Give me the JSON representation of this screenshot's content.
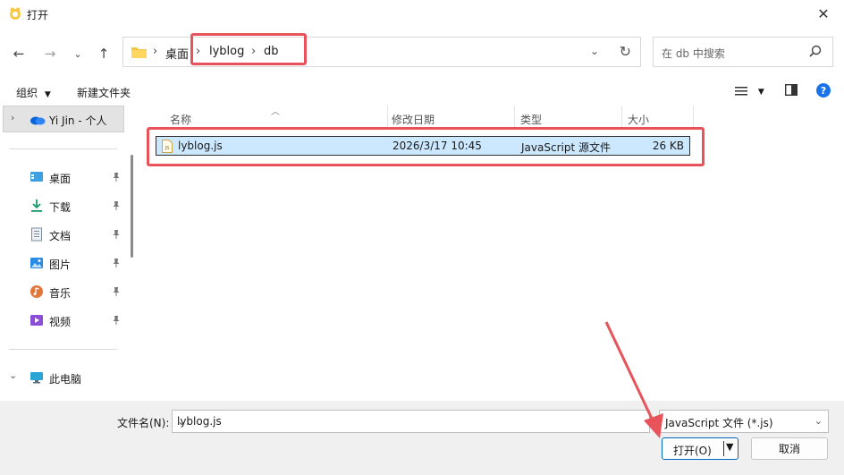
{
  "window": {
    "title": "打开"
  },
  "address": {
    "crumbs": [
      "桌面",
      "lyblog",
      "db"
    ],
    "separator": "›"
  },
  "search": {
    "placeholder": "在 db 中搜索"
  },
  "toolbar": {
    "organize": "组织",
    "new_folder": "新建文件夹"
  },
  "sidebar": {
    "account": "Yi Jin - 个人",
    "items": [
      {
        "label": "桌面",
        "icon": "desktop-icon"
      },
      {
        "label": "下载",
        "icon": "download-icon"
      },
      {
        "label": "文档",
        "icon": "document-icon"
      },
      {
        "label": "图片",
        "icon": "pictures-icon"
      },
      {
        "label": "音乐",
        "icon": "music-icon"
      },
      {
        "label": "视频",
        "icon": "video-icon"
      }
    ],
    "this_pc": "此电脑"
  },
  "columns": {
    "name": "名称",
    "date": "修改日期",
    "type": "类型",
    "size": "大小"
  },
  "files": [
    {
      "name": "lyblog.js",
      "date": "2026/3/17 10:45",
      "type": "JavaScript 源文件",
      "size": "26 KB"
    }
  ],
  "bottom": {
    "filename_label": "文件名(N):",
    "filename_value": "lyblog.js",
    "filetype_value": "JavaScript 文件 (*.js)",
    "open_label": "打开(O)",
    "cancel_label": "取消"
  },
  "colors": {
    "accent": "#0067c0",
    "selection": "#cce8ff",
    "annotation": "#e8525a"
  }
}
